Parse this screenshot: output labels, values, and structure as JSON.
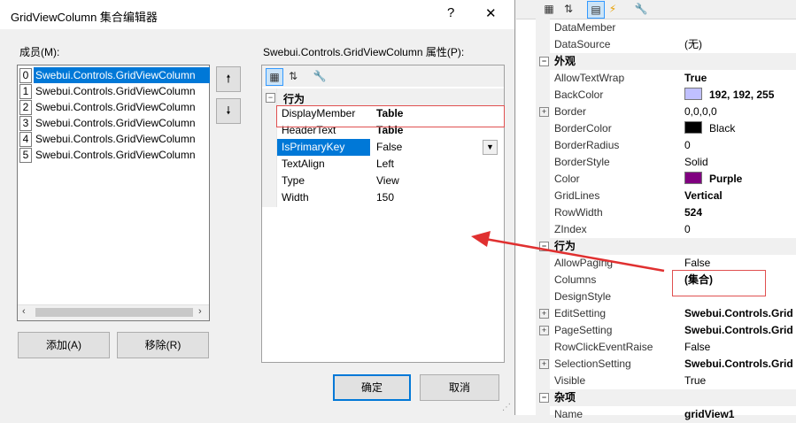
{
  "dialog": {
    "title": "GridViewColumn 集合编辑器",
    "help_glyph": "?",
    "close_glyph": "✕",
    "members_label": "成员(M):",
    "members": [
      {
        "index": "0",
        "name": "Swebui.Controls.GridViewColumn"
      },
      {
        "index": "1",
        "name": "Swebui.Controls.GridViewColumn"
      },
      {
        "index": "2",
        "name": "Swebui.Controls.GridViewColumn"
      },
      {
        "index": "3",
        "name": "Swebui.Controls.GridViewColumn"
      },
      {
        "index": "4",
        "name": "Swebui.Controls.GridViewColumn"
      },
      {
        "index": "5",
        "name": "Swebui.Controls.GridViewColumn"
      }
    ],
    "move_up_glyph": "🠕",
    "move_down_glyph": "🠗",
    "add_button": "添加(A)",
    "remove_button": "移除(R)",
    "props_label": "Swebui.Controls.GridViewColumn 属性(P):",
    "props_category": "行为",
    "props": [
      {
        "name": "DisplayMember",
        "value": "Table"
      },
      {
        "name": "HeaderText",
        "value": "Table"
      },
      {
        "name": "IsPrimaryKey",
        "value": "False"
      },
      {
        "name": "TextAlign",
        "value": "Left"
      },
      {
        "name": "Type",
        "value": "View"
      },
      {
        "name": "Width",
        "value": "150"
      }
    ],
    "ok_button": "确定",
    "cancel_button": "取消"
  },
  "property_grid": {
    "rows": [
      {
        "kind": "prop",
        "name": "DataMember",
        "value": ""
      },
      {
        "kind": "prop",
        "name": "DataSource",
        "value": "(无)"
      },
      {
        "kind": "cat",
        "name": "外观"
      },
      {
        "kind": "prop",
        "name": "AllowTextWrap",
        "value": "True"
      },
      {
        "kind": "prop",
        "name": "BackColor",
        "value": "192, 192, 255"
      },
      {
        "kind": "prop",
        "name": "Border",
        "value": "0,0,0,0"
      },
      {
        "kind": "prop",
        "name": "BorderColor",
        "value": "Black"
      },
      {
        "kind": "prop",
        "name": "BorderRadius",
        "value": "0"
      },
      {
        "kind": "prop",
        "name": "BorderStyle",
        "value": "Solid"
      },
      {
        "kind": "prop",
        "name": "Color",
        "value": "Purple"
      },
      {
        "kind": "prop",
        "name": "GridLines",
        "value": "Vertical"
      },
      {
        "kind": "prop",
        "name": "RowWidth",
        "value": "524"
      },
      {
        "kind": "prop",
        "name": "ZIndex",
        "value": "0"
      },
      {
        "kind": "cat",
        "name": "行为"
      },
      {
        "kind": "prop",
        "name": "AllowPaging",
        "value": "False"
      },
      {
        "kind": "prop",
        "name": "Columns",
        "value": "(集合)"
      },
      {
        "kind": "prop",
        "name": "DesignStyle",
        "value": ""
      },
      {
        "kind": "prop",
        "name": "EditSetting",
        "value": "Swebui.Controls.Grid"
      },
      {
        "kind": "prop",
        "name": "PageSetting",
        "value": "Swebui.Controls.Grid"
      },
      {
        "kind": "prop",
        "name": "RowClickEventRaise",
        "value": "False"
      },
      {
        "kind": "prop",
        "name": "SelectionSetting",
        "value": "Swebui.Controls.Grid"
      },
      {
        "kind": "prop",
        "name": "Visible",
        "value": "True"
      },
      {
        "kind": "cat",
        "name": "杂项"
      },
      {
        "kind": "prop",
        "name": "Name",
        "value": "gridView1"
      }
    ],
    "colors": {
      "backcolor": "#c0c0ff",
      "bordercolor": "#000000",
      "color": "#800080",
      "highlight_box": "#e05050",
      "arrow": "#e03030",
      "selection": "#0078d7"
    }
  }
}
